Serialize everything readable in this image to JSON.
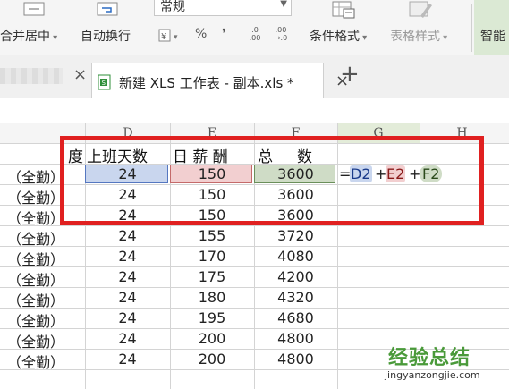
{
  "ribbon": {
    "merge_center": "合并居中",
    "wrap_text": "自动换行",
    "number_format": "常规",
    "percent": "%",
    "comma": "❜",
    "dec_inc": ".0 .00",
    "dec_dec": ".00 →.0",
    "conditional_format": "条件格式",
    "table_style": "表格样式",
    "smart": "智能"
  },
  "tabbar": {
    "tab_title": "新建 XLS 工作表 - 副本.xls *",
    "close": "×",
    "left_close": "×",
    "add": "+"
  },
  "columns": [
    "D",
    "E",
    "F",
    "G",
    "H"
  ],
  "header_row": {
    "b_partial": "度",
    "d": "上班天数",
    "e": "日 薪 酬",
    "f": "总     数"
  },
  "formula": {
    "eq": "=",
    "r1": "D2",
    "p1": "+",
    "r2": "E2",
    "p2": "+",
    "r3": "F2"
  },
  "rows": [
    {
      "b": "（全勤）",
      "d": "24",
      "e": "150",
      "f": "3600"
    },
    {
      "b": "（全勤）",
      "d": "24",
      "e": "150",
      "f": "3600"
    },
    {
      "b": "（全勤）",
      "d": "24",
      "e": "150",
      "f": "3600"
    },
    {
      "b": "（全勤）",
      "d": "24",
      "e": "155",
      "f": "3720"
    },
    {
      "b": "（全勤）",
      "d": "24",
      "e": "170",
      "f": "4080"
    },
    {
      "b": "（全勤）",
      "d": "24",
      "e": "175",
      "f": "4200"
    },
    {
      "b": "（全勤）",
      "d": "24",
      "e": "180",
      "f": "4320"
    },
    {
      "b": "（全勤）",
      "d": "24",
      "e": "195",
      "f": "4680"
    },
    {
      "b": "（全勤）",
      "d": "24",
      "e": "200",
      "f": "4800"
    },
    {
      "b": "（全勤）",
      "d": "24",
      "e": "200",
      "f": "4800"
    }
  ],
  "watermark": {
    "title": "经验总结",
    "url": "jingyanzongjie.com"
  },
  "colors": {
    "highlight_red": "#e02020",
    "ref_blue": "#c9d6ee",
    "ref_pink": "#f2cfd0",
    "ref_green": "#cfdcc6",
    "tab_icon_green": "#2f8f3a"
  },
  "icons": [
    "merge-center-icon",
    "wrap-text-icon",
    "number-format-icon",
    "conditional-format-icon",
    "table-style-icon",
    "file-icon",
    "add-tab-icon",
    "close-tab-icon"
  ]
}
